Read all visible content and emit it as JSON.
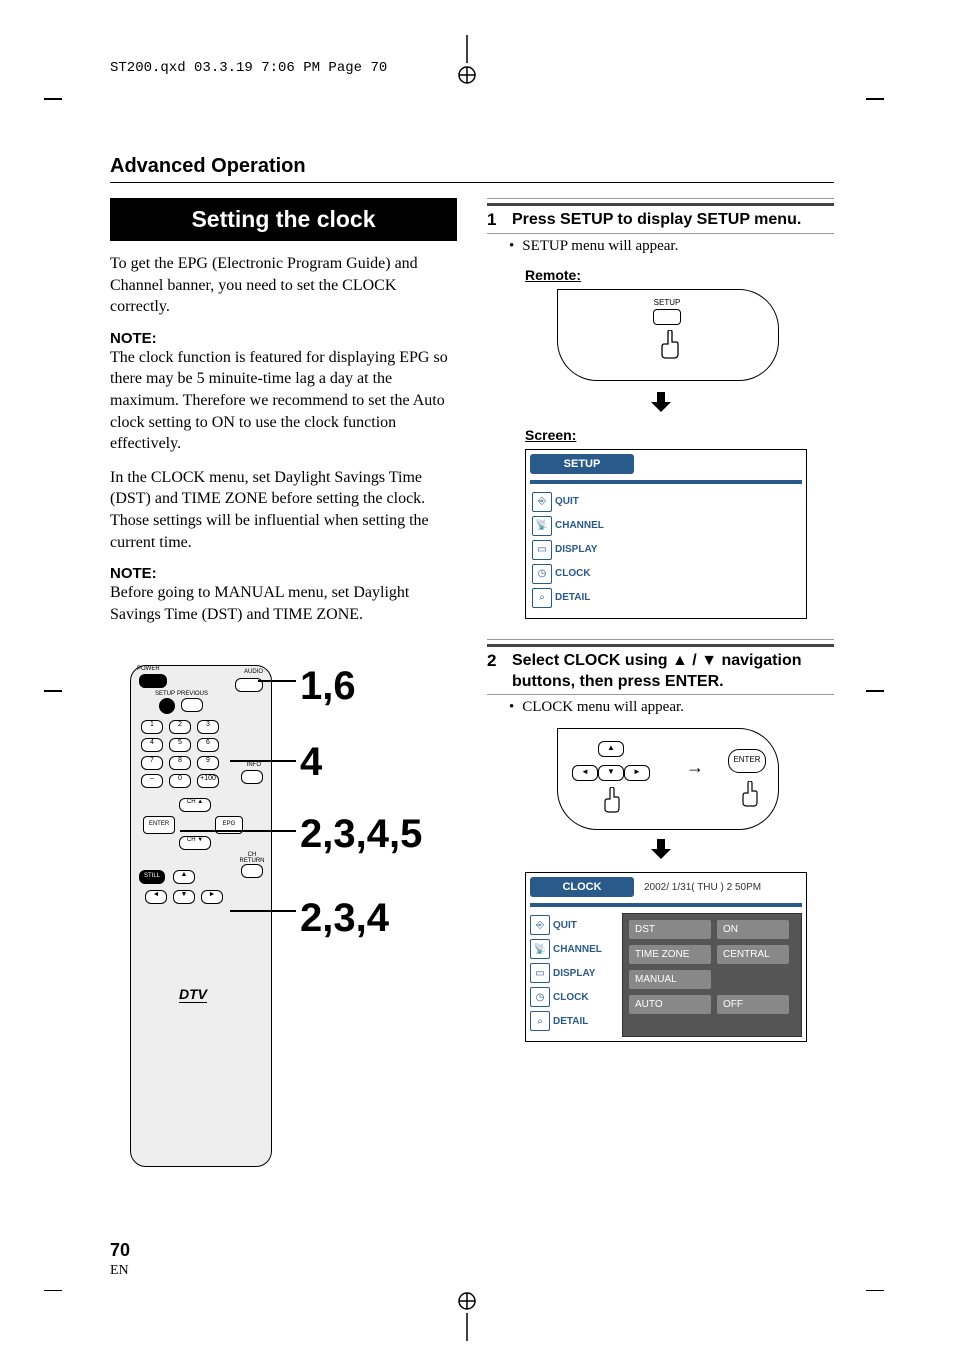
{
  "meta": {
    "header_line": "ST200.qxd  03.3.19 7:06 PM  Page 70"
  },
  "section_title": "Advanced Operation",
  "banner": "Setting the clock",
  "intro": "To get the EPG (Electronic Program Guide) and Channel banner, you need to set the CLOCK correctly.",
  "note1_label": "NOTE:",
  "note1_body": "The clock function is featured for displaying EPG so there may be 5 minuite-time lag a day at the maximum. Therefore we recommend to set the Auto clock setting to ON to use the clock function effectively.",
  "para2": "In the CLOCK menu, set Daylight Savings Time (DST) and TIME ZONE before setting the clock. Those settings will be influential when setting the current time.",
  "note2_label": "NOTE:",
  "note2_body": "Before going to MANUAL menu, set Daylight Savings Time (DST) and TIME ZONE.",
  "callouts": {
    "c1": "1,6",
    "c2": "4",
    "c3": "2,3,4,5",
    "c4": "2,3,4"
  },
  "step1": {
    "num": "1",
    "text": "Press SETUP to display SETUP menu.",
    "bullet": "SETUP menu will appear.",
    "remote_label": "Remote:",
    "screen_label": "Screen:",
    "setup_btn": "SETUP"
  },
  "setup_screen": {
    "tab": "SETUP",
    "items": [
      "QUIT",
      "CHANNEL",
      "DISPLAY",
      "CLOCK",
      "DETAIL"
    ]
  },
  "step2": {
    "num": "2",
    "text": "Select CLOCK using ▲ / ▼ navigation buttons, then press ENTER.",
    "bullet": "CLOCK menu will appear.",
    "enter_btn": "ENTER"
  },
  "clock_screen": {
    "tab": "CLOCK",
    "header": "2002/   1/31( THU )   2 50PM",
    "items": [
      "QUIT",
      "CHANNEL",
      "DISPLAY",
      "CLOCK",
      "DETAIL"
    ],
    "rows": [
      {
        "l": "DST",
        "r": "ON"
      },
      {
        "l": "TIME ZONE",
        "r": "CENTRAL"
      },
      {
        "l": "MANUAL",
        "r": ""
      },
      {
        "l": "AUTO",
        "r": "OFF"
      }
    ]
  },
  "remote_labels": {
    "power": "POWER",
    "audio": "AUDIO",
    "setup": "SETUP",
    "previous": "PREVIOUS",
    "info": "INFO",
    "cha": "CH ▲",
    "chv": "CH ▼",
    "enter": "ENTER",
    "epg": "EPG",
    "ch_return": "CH RETURN",
    "still": "STILL",
    "dtv": "DTV"
  },
  "page": {
    "num": "70",
    "lang": "EN"
  }
}
